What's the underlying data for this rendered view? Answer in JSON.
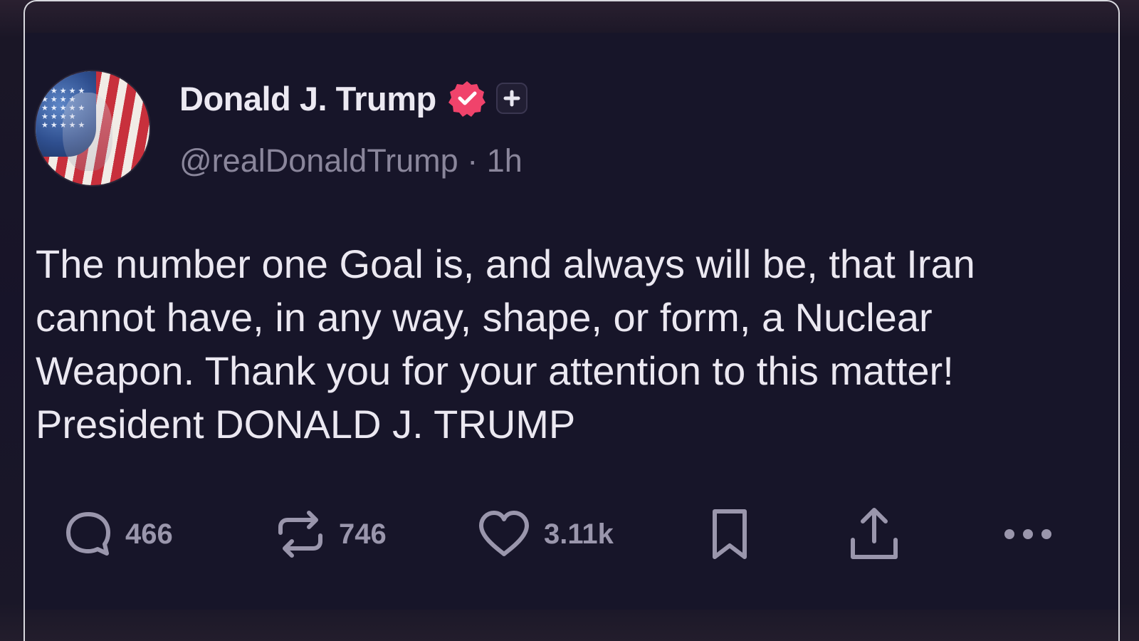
{
  "post": {
    "author": {
      "display_name": "Donald J. Trump",
      "handle": "@realDonaldTrump",
      "separator": "·",
      "time": "1h",
      "verified_color": "#f0436b"
    },
    "body": "The number one Goal is, and always will be, that Iran cannot have, in any way, shape, or form, a Nuclear Weapon. Thank you for your attention to this matter! President DONALD J. TRUMP",
    "actions": {
      "replies": "466",
      "reposts": "746",
      "likes": "3.11k"
    }
  },
  "icons": [
    "verified-badge-icon",
    "plus-icon",
    "reply-icon",
    "repost-icon",
    "like-icon",
    "bookmark-icon",
    "share-icon",
    "more-icon"
  ],
  "colors": {
    "background": "#171529",
    "text": "#ebe8f1",
    "muted": "#8a869b",
    "verified": "#f0436b"
  }
}
